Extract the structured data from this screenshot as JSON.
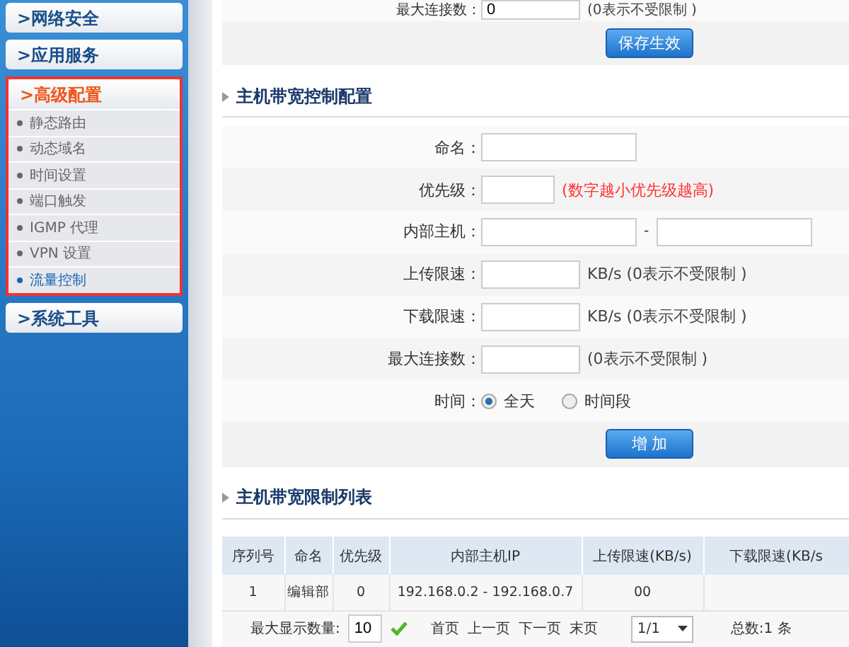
{
  "sidebar": {
    "groups": [
      {
        "label": ">网络安全",
        "expanded": false
      },
      {
        "label": ">应用服务",
        "expanded": false
      },
      {
        "label": ">高级配置",
        "expanded": true,
        "items": [
          {
            "label": "静态路由",
            "selected": false
          },
          {
            "label": "动态域名",
            "selected": false
          },
          {
            "label": "时间设置",
            "selected": false
          },
          {
            "label": "端口触发",
            "selected": false
          },
          {
            "label": "IGMP 代理",
            "selected": false
          },
          {
            "label": "VPN 设置",
            "selected": false
          },
          {
            "label": "流量控制",
            "selected": true
          }
        ]
      },
      {
        "label": ">系统工具",
        "expanded": false
      }
    ]
  },
  "top_row": {
    "label": "最大连接数：",
    "value": "0",
    "hint": "(0表示不受限制 )"
  },
  "save_button": "保存生效",
  "config": {
    "title": "主机带宽控制配置",
    "fields": [
      {
        "kind": "name",
        "label": "命名："
      },
      {
        "kind": "number",
        "label": "优先级：",
        "hint": "(数字越小优先级越高)",
        "warning": true
      },
      {
        "kind": "range",
        "label": "内部主机：",
        "separator": "-"
      },
      {
        "kind": "rate",
        "label": "上传限速：",
        "hint": "KB/s (0表示不受限制 )",
        "warning": false
      },
      {
        "kind": "rate",
        "label": "下载限速：",
        "hint": "KB/s (0表示不受限制 )",
        "warning": false
      },
      {
        "kind": "rate",
        "label": "最大连接数：",
        "hint": "(0表示不受限制 )",
        "warning": false
      },
      {
        "kind": "radio",
        "label": "时间：",
        "options": [
          {
            "label": "全天",
            "selected": true
          },
          {
            "label": "时间段",
            "selected": false
          }
        ]
      }
    ],
    "button": "增 加"
  },
  "list": {
    "title": "主机带宽限制列表",
    "columns": [
      "序列号",
      "命名",
      "优先级",
      "内部主机IP",
      "上传限速(KB/s)",
      "下载限速(KB/s"
    ],
    "rows": [
      [
        "1",
        "编辑部",
        "0",
        "192.168.0.2 - 192.168.0.7",
        "00"
      ]
    ],
    "footer": {
      "label": "最大显示数量:",
      "value": "10",
      "links": [
        "首页",
        "上一页",
        "下一页",
        "末页"
      ],
      "page": "1/1",
      "total": "总数:1 条"
    }
  }
}
